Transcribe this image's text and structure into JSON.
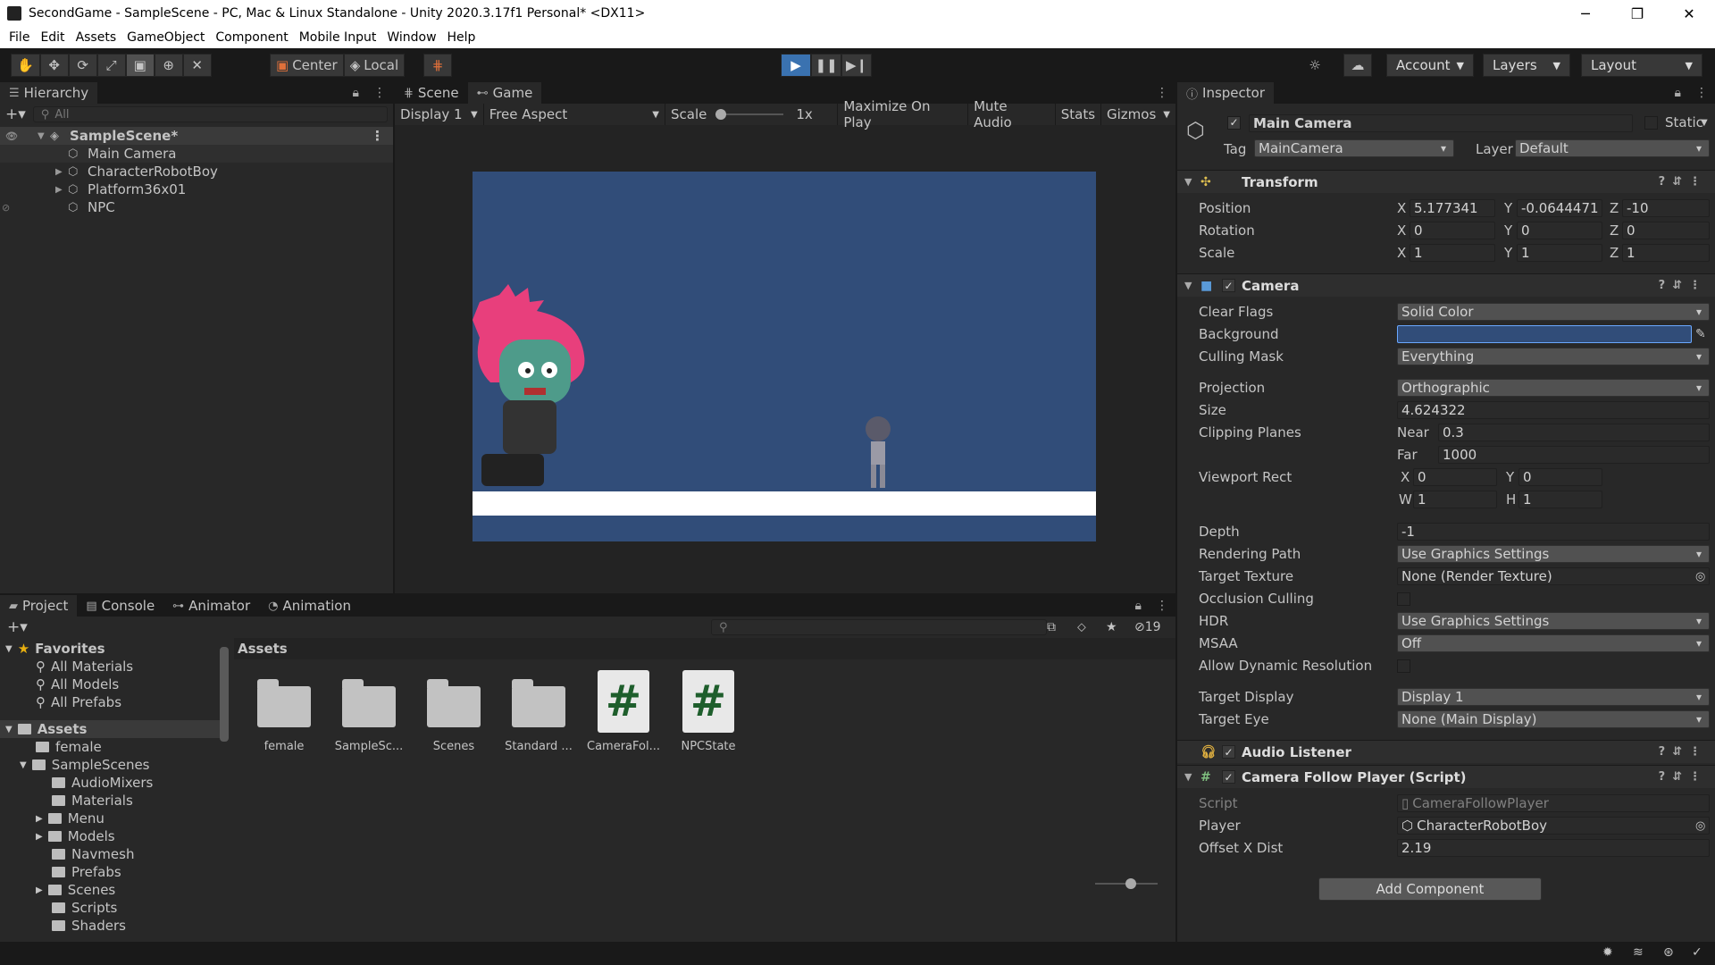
{
  "window": {
    "title": "SecondGame - SampleScene - PC, Mac & Linux Standalone - Unity 2020.3.17f1 Personal* <DX11>",
    "controls": [
      "─",
      "❐",
      "✕"
    ]
  },
  "menu": [
    "File",
    "Edit",
    "Assets",
    "GameObject",
    "Component",
    "Mobile Input",
    "Window",
    "Help"
  ],
  "toolbar": {
    "pivot": "Center",
    "space": "Local",
    "account": "Account",
    "layers": "Layers",
    "layout": "Layout"
  },
  "hierarchy": {
    "tab": "Hierarchy",
    "search_placeholder": "All",
    "scene": "SampleScene*",
    "items": [
      "Main Camera",
      "CharacterRobotBoy",
      "Platform36x01",
      "NPC"
    ]
  },
  "game": {
    "tabs": [
      "Scene",
      "Game"
    ],
    "display": "Display 1",
    "aspect": "Free Aspect",
    "scale_label": "Scale",
    "scale_value": "1x",
    "buttons": [
      "Maximize On Play",
      "Mute Audio",
      "Stats",
      "Gizmos"
    ],
    "colors": {
      "background": "#314d79",
      "platform": "#ffffff"
    }
  },
  "inspector": {
    "tab": "Inspector",
    "object_name": "Main Camera",
    "static_label": "Static",
    "tag_label": "Tag",
    "tag": "MainCamera",
    "layer_label": "Layer",
    "layer": "Default",
    "transform": {
      "title": "Transform",
      "position": {
        "label": "Position",
        "x": "5.177341",
        "y": "-0.0644471",
        "z": "-10"
      },
      "rotation": {
        "label": "Rotation",
        "x": "0",
        "y": "0",
        "z": "0"
      },
      "scale": {
        "label": "Scale",
        "x": "1",
        "y": "1",
        "z": "1"
      }
    },
    "camera": {
      "title": "Camera",
      "clear_flags": {
        "label": "Clear Flags",
        "value": "Solid Color"
      },
      "background": {
        "label": "Background",
        "color": "#314d79"
      },
      "culling_mask": {
        "label": "Culling Mask",
        "value": "Everything"
      },
      "projection": {
        "label": "Projection",
        "value": "Orthographic"
      },
      "size": {
        "label": "Size",
        "value": "4.624322"
      },
      "clipping": {
        "label": "Clipping Planes",
        "near_label": "Near",
        "near": "0.3",
        "far_label": "Far",
        "far": "1000"
      },
      "viewport": {
        "label": "Viewport Rect",
        "x": "0",
        "y": "0",
        "w": "1",
        "h": "1"
      },
      "depth": {
        "label": "Depth",
        "value": "-1"
      },
      "rendering_path": {
        "label": "Rendering Path",
        "value": "Use Graphics Settings"
      },
      "target_texture": {
        "label": "Target Texture",
        "value": "None (Render Texture)"
      },
      "occlusion": {
        "label": "Occlusion Culling"
      },
      "hdr": {
        "label": "HDR",
        "value": "Use Graphics Settings"
      },
      "msaa": {
        "label": "MSAA",
        "value": "Off"
      },
      "dynamic_res": {
        "label": "Allow Dynamic Resolution"
      },
      "target_display": {
        "label": "Target Display",
        "value": "Display 1"
      },
      "target_eye": {
        "label": "Target Eye",
        "value": "None (Main Display)"
      }
    },
    "audio_listener": {
      "title": "Audio Listener"
    },
    "follow_script": {
      "title": "Camera Follow Player (Script)",
      "script": {
        "label": "Script",
        "value": "CameraFollowPlayer"
      },
      "player": {
        "label": "Player",
        "value": "CharacterRobotBoy"
      },
      "offset": {
        "label": "Offset X Dist",
        "value": "2.19"
      }
    },
    "add_component": "Add Component"
  },
  "project": {
    "tabs": [
      "Project",
      "Console",
      "Animator",
      "Animation"
    ],
    "hidden_count": "19",
    "favorites_label": "Favorites",
    "favorites": [
      "All Materials",
      "All Models",
      "All Prefabs"
    ],
    "assets_label": "Assets",
    "tree": [
      "female",
      "SampleScenes",
      "AudioMixers",
      "Materials",
      "Menu",
      "Models",
      "Navmesh",
      "Prefabs",
      "Scenes",
      "Scripts",
      "Shaders"
    ],
    "breadcrumb": "Assets",
    "grid": [
      {
        "name": "female",
        "kind": "folder"
      },
      {
        "name": "SampleSc...",
        "kind": "folder"
      },
      {
        "name": "Scenes",
        "kind": "folder"
      },
      {
        "name": "Standard ...",
        "kind": "folder"
      },
      {
        "name": "CameraFol...",
        "kind": "script"
      },
      {
        "name": "NPCState",
        "kind": "script"
      }
    ]
  }
}
